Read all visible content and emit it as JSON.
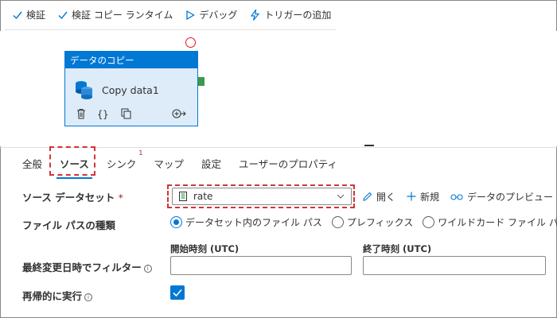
{
  "toolbar": {
    "validate": "検証",
    "validate_copy_runtime": "検証 コピー ランタイム",
    "debug": "デバッグ",
    "add_trigger": "トリガーの追加"
  },
  "activity": {
    "header": "データのコピー",
    "name": "Copy data1"
  },
  "tabs": [
    {
      "label": "全般"
    },
    {
      "label": "ソース"
    },
    {
      "label": "シンク",
      "badge": "1"
    },
    {
      "label": "マップ"
    },
    {
      "label": "設定"
    },
    {
      "label": "ユーザーのプロパティ"
    }
  ],
  "form": {
    "source_dataset_label": "ソース データセット",
    "required_mark": "*",
    "dataset_value": "rate",
    "open_label": "開く",
    "new_label": "新規",
    "preview_label": "データのプレビュー",
    "file_path_type_label": "ファイル パスの種類",
    "radio_options": [
      {
        "label": "データセット内のファイル パス",
        "selected": true
      },
      {
        "label": "プレフィックス",
        "selected": false
      },
      {
        "label": "ワイルドカード ファイル パス",
        "selected": false
      }
    ],
    "filter_label": "最終変更日時でフィルター",
    "start_time_label": "開始時刻 (UTC)",
    "end_time_label": "終了時刻 (UTC)",
    "recursive_label": "再帰的に実行",
    "recursive_checked": true
  },
  "colors": {
    "accent": "#0078d4",
    "highlight": "#d13438",
    "success_port": "#3a9a49"
  }
}
